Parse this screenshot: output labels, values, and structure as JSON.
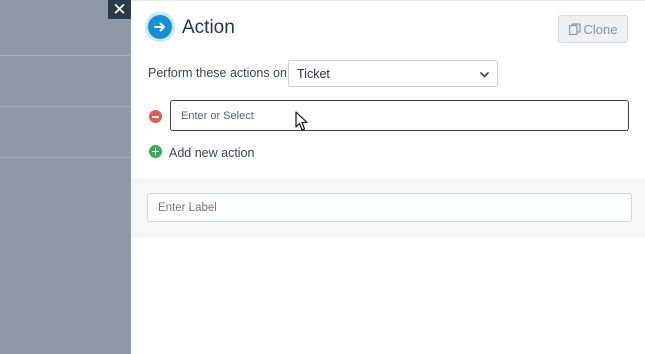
{
  "close_glyph": "✕",
  "panel": {
    "title": "Action",
    "clone_label": "Clone",
    "perform_label": "Perform these actions on",
    "perform_select_value": "Ticket",
    "action_input_placeholder": "Enter or Select",
    "add_action_label": "Add new action",
    "label_input_placeholder": "Enter Label"
  },
  "icons": {
    "header": "arrow-right-icon",
    "clone": "copy-icon",
    "select": "chevron-down-icon",
    "remove": "minus-circle-icon",
    "add": "plus-circle-icon",
    "close": "close-icon"
  },
  "colors": {
    "accent": "#1b8fd1",
    "remove": "#e05a5a",
    "add": "#3cab5b",
    "overlay": "#8e9aa7"
  }
}
